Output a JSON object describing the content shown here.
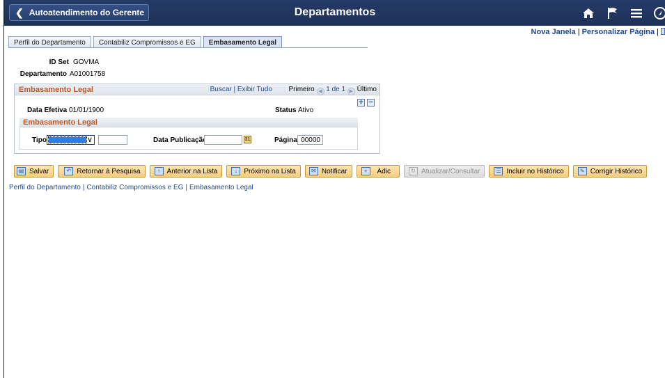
{
  "header": {
    "back_label": "Autoatendimento do Gerente",
    "title": "Departamentos",
    "icons": [
      "home-icon",
      "flag-icon",
      "menu-icon",
      "navbar-icon"
    ]
  },
  "toplinks": {
    "new_window": "Nova Janela",
    "personalize": "Personalizar Página",
    "sep": "|"
  },
  "tabs": [
    {
      "label": "Perfil do Departamento",
      "active": false
    },
    {
      "label": "Contabiliz Compromissos e EG",
      "active": false
    },
    {
      "label": "Embasamento Legal",
      "active": true
    }
  ],
  "fields": {
    "setid_label": "ID Set",
    "setid_value": "GOVMA",
    "dept_label": "Departamento",
    "dept_value": "A01001758"
  },
  "group": {
    "title": "Embasamento Legal",
    "find": "Buscar",
    "view_all": "Exibir Tudo",
    "first": "Primeiro",
    "pos": "1 de 1",
    "last": "Último",
    "eff_date_label": "Data Efetiva",
    "eff_date_value": "01/01/1900",
    "status_label": "Status",
    "status_value": "Ativo",
    "sub_title": "Embasamento Legal",
    "type_label": "Tipo",
    "pub_date_label": "Data Publicação",
    "page_label": "Página",
    "page_value": "00000"
  },
  "toolbar": [
    {
      "label": "Salvar",
      "icon": "save-icon",
      "disabled": false
    },
    {
      "label": "Retornar à Pesquisa",
      "icon": "return-icon",
      "disabled": false
    },
    {
      "label": "Anterior na Lista",
      "icon": "previous-icon",
      "disabled": false
    },
    {
      "label": "Próximo na Lista",
      "icon": "next-icon",
      "disabled": false
    },
    {
      "label": "Notificar",
      "icon": "notify-icon",
      "disabled": false
    },
    {
      "label": "Adic",
      "icon": "add-icon",
      "disabled": false
    },
    {
      "label": "Atualizar/Consultar",
      "icon": "update-icon",
      "disabled": true
    },
    {
      "label": "Incluir no Histórico",
      "icon": "include-history-icon",
      "disabled": false
    },
    {
      "label": "Corrigir Histórico",
      "icon": "correct-history-icon",
      "disabled": false
    }
  ],
  "bottom_links": {
    "link1": "Perfil do Departamento",
    "link2": "Contabiliz Compromissos e EG",
    "link3": "Embasamento Legal",
    "sep": "|"
  },
  "colors": {
    "header_bg": "#1d3159",
    "group_title": "#c0561f",
    "link": "#1f4b8f",
    "button_bg": "#f6cd7c"
  }
}
